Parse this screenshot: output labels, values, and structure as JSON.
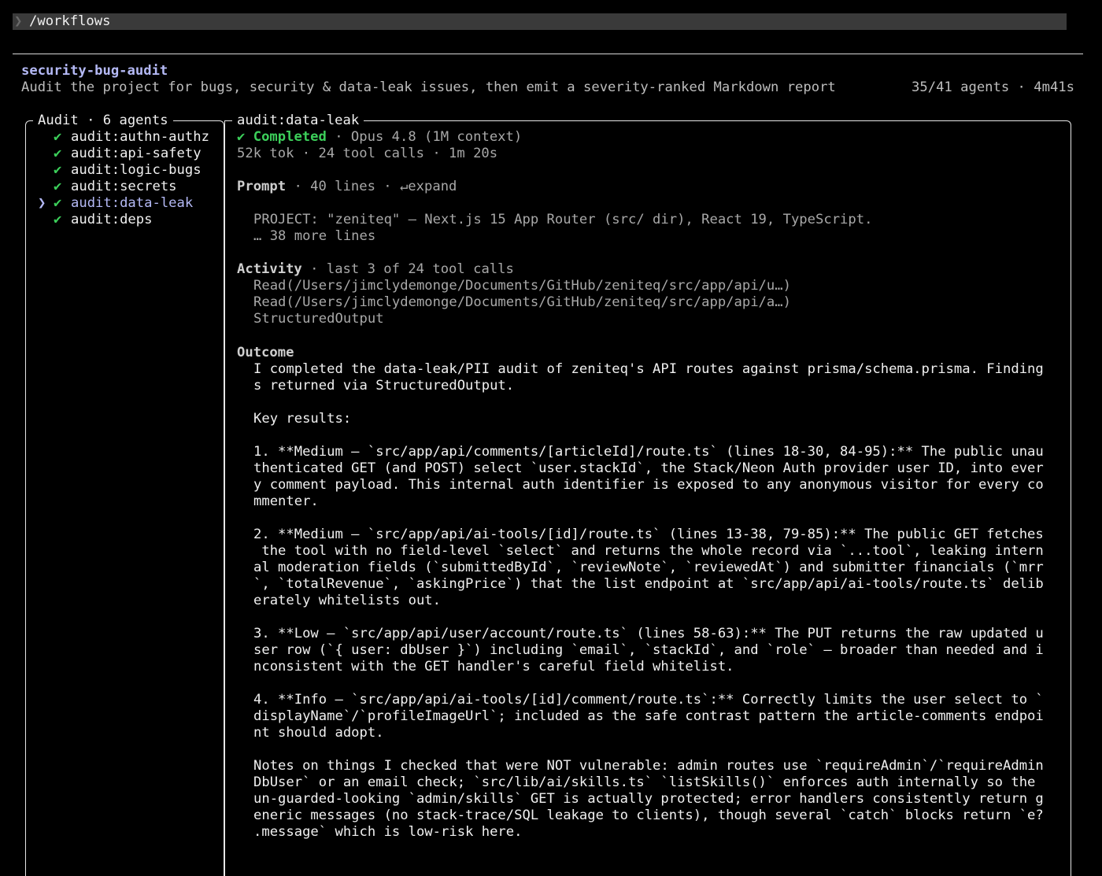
{
  "command_bar": {
    "prompt_symbol": "❯",
    "command": "/workflows"
  },
  "workflow": {
    "title": "security-bug-audit",
    "description": "Audit the project for bugs, security & data-leak issues, then emit a severity-ranked Markdown report",
    "stats": "35/41 agents · 4m41s"
  },
  "left_panel": {
    "title": "Audit · 6 agents",
    "agents": [
      {
        "name": "audit:authn-authz",
        "status": "✔",
        "selected": ""
      },
      {
        "name": "audit:api-safety",
        "status": "✔",
        "selected": ""
      },
      {
        "name": "audit:logic-bugs",
        "status": "✔",
        "selected": ""
      },
      {
        "name": "audit:secrets",
        "status": "✔",
        "selected": ""
      },
      {
        "name": "audit:data-leak",
        "status": "✔",
        "selected": "❯"
      },
      {
        "name": "audit:deps",
        "status": "✔",
        "selected": ""
      }
    ]
  },
  "detail": {
    "title": "audit:data-leak",
    "status_mark": "✔",
    "status_label": "Completed",
    "model": " · Opus 4.8 (1M context)",
    "metrics": "52k tok · 24 tool calls · 1m 20s",
    "prompt_heading": "Prompt",
    "prompt_meta": " · 40 lines · ↵expand",
    "prompt_lines": [
      "PROJECT: \"zeniteq\" — Next.js 15 App Router (src/ dir), React 19, TypeScript.",
      "… 38 more lines"
    ],
    "activity_heading": "Activity",
    "activity_meta": " · last 3 of 24 tool calls",
    "activity_lines": [
      "Read(/Users/jimclydemonge/Documents/GitHub/zeniteq/src/app/api/u…)",
      "Read(/Users/jimclydemonge/Documents/GitHub/zeniteq/src/app/api/a…)",
      "StructuredOutput"
    ],
    "outcome_heading": "Outcome",
    "outcome_lines": [
      "I completed the data-leak/PII audit of zeniteq's API routes against prisma/schema.prisma. Finding",
      "s returned via StructuredOutput.",
      "",
      "Key results:",
      "",
      "1. **Medium — `src/app/api/comments/[articleId]/route.ts` (lines 18-30, 84-95):** The public unau",
      "thenticated GET (and POST) select `user.stackId`, the Stack/Neon Auth provider user ID, into ever",
      "y comment payload. This internal auth identifier is exposed to any anonymous visitor for every co",
      "mmenter.",
      "",
      "2. **Medium — `src/app/api/ai-tools/[id]/route.ts` (lines 13-38, 79-85):** The public GET fetches",
      " the tool with no field-level `select` and returns the whole record via `...tool`, leaking intern",
      "al moderation fields (`submittedById`, `reviewNote`, `reviewedAt`) and submitter financials (`mrr",
      "`, `totalRevenue`, `askingPrice`) that the list endpoint at `src/app/api/ai-tools/route.ts` delib",
      "erately whitelists out.",
      "",
      "3. **Low — `src/app/api/user/account/route.ts` (lines 58-63):** The PUT returns the raw updated u",
      "ser row (`{ user: dbUser }`) including `email`, `stackId`, and `role` — broader than needed and i",
      "nconsistent with the GET handler's careful field whitelist.",
      "",
      "4. **Info — `src/app/api/ai-tools/[id]/comment/route.ts`:** Correctly limits the user select to `",
      "displayName`/`profileImageUrl`; included as the safe contrast pattern the article-comments endpoi",
      "nt should adopt.",
      "",
      "Notes on things I checked that were NOT vulnerable: admin routes use `requireAdmin`/`requireAdmin",
      "DbUser` or an email check; `src/lib/ai/skills.ts` `listSkills()` enforces auth internally so the",
      "un-guarded-looking `admin/skills` GET is actually protected; error handlers consistently return g",
      "eneric messages (no stack-trace/SQL leakage to clients), though several `catch` blocks return `e?",
      ".message` which is low-risk here."
    ]
  },
  "colors": {
    "background": "#000000",
    "accent": "#b4b9f5",
    "success": "#3ccf5a",
    "text": "#f0f0f0",
    "dim": "#a8a8a8"
  }
}
